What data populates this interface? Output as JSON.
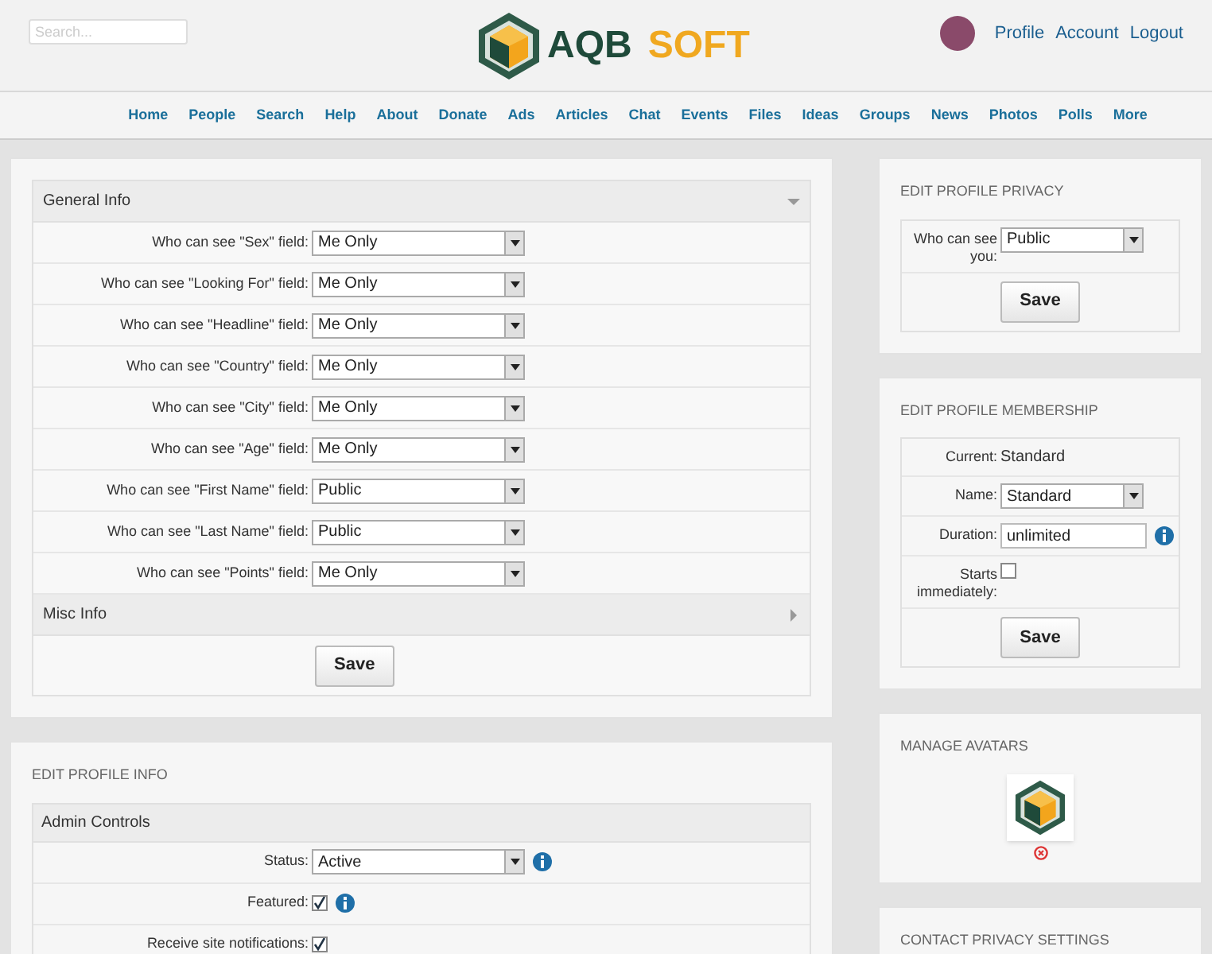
{
  "header": {
    "search": {
      "placeholder": "Search..."
    },
    "logo": {
      "text_1": "AQB",
      "text_2": "SOFT"
    },
    "user_links": [
      "Profile",
      "Account",
      "Logout"
    ]
  },
  "nav": [
    "Home",
    "People",
    "Search",
    "Help",
    "About",
    "Donate",
    "Ads",
    "Articles",
    "Chat",
    "Events",
    "Files",
    "Ideas",
    "Groups",
    "News",
    "Photos",
    "Polls",
    "More"
  ],
  "privacy_panel": {
    "sections": [
      {
        "title": "General Info",
        "expanded": true,
        "rows": [
          {
            "label": "Who can see \"Sex\" field:",
            "value": "Me Only"
          },
          {
            "label": "Who can see \"Looking For\" field:",
            "value": "Me Only"
          },
          {
            "label": "Who can see \"Headline\" field:",
            "value": "Me Only"
          },
          {
            "label": "Who can see \"Country\" field:",
            "value": "Me Only"
          },
          {
            "label": "Who can see \"City\" field:",
            "value": "Me Only"
          },
          {
            "label": "Who can see \"Age\" field:",
            "value": "Me Only"
          },
          {
            "label": "Who can see \"First Name\" field:",
            "value": "Public"
          },
          {
            "label": "Who can see \"Last Name\" field:",
            "value": "Public"
          },
          {
            "label": "Who can see \"Points\" field:",
            "value": "Me Only"
          }
        ]
      },
      {
        "title": "Misc Info",
        "expanded": false
      }
    ],
    "button": "Save"
  },
  "profile_info_panel": {
    "title": "EDIT PROFILE INFO",
    "section": "Admin Controls",
    "rows": [
      {
        "kind": "select",
        "label": "Status:",
        "value": "Active",
        "info": true
      },
      {
        "kind": "checkbox",
        "label": "Featured:",
        "checked": true,
        "info": true
      },
      {
        "kind": "checkbox",
        "label": "Receive site notifications:",
        "checked": true,
        "info": false
      }
    ]
  },
  "profile_privacy": {
    "title": "EDIT PROFILE PRIVACY",
    "rows": [
      {
        "kind": "select",
        "label": "Who can see you:",
        "value": "Public",
        "info": false
      }
    ],
    "button": "Save"
  },
  "membership": {
    "title": "EDIT PROFILE MEMBERSHIP",
    "rows": [
      {
        "kind": "text",
        "label": "Current:",
        "value": "Standard",
        "info": false
      },
      {
        "kind": "select",
        "label": "Name:",
        "value": "Standard",
        "info": false
      },
      {
        "kind": "input",
        "label": "Duration:",
        "value": "unlimited",
        "info": true
      },
      {
        "kind": "checkbox",
        "label": "Starts immediately:",
        "checked": false,
        "info": false
      }
    ],
    "button": "Save"
  },
  "avatars": {
    "title": "MANAGE AVATARS"
  },
  "contact_privacy": {
    "title": "CONTACT PRIVACY SETTINGS"
  }
}
